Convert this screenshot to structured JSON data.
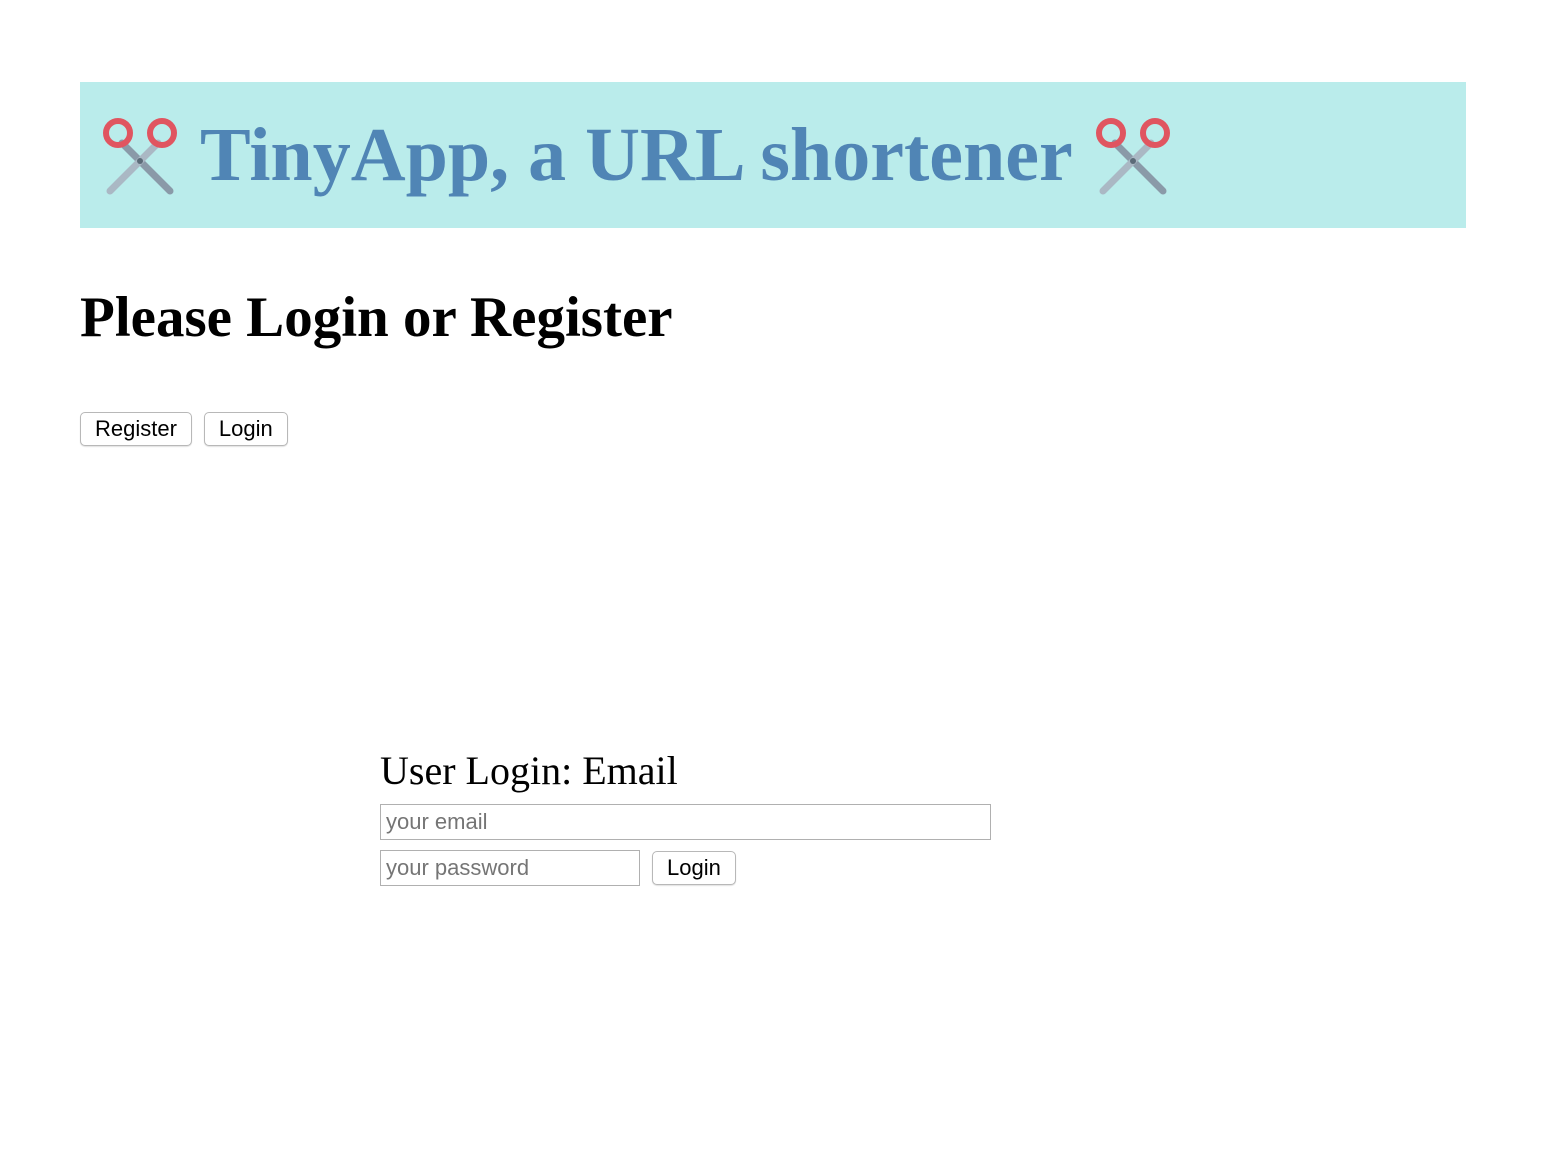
{
  "header": {
    "title": "TinyApp, a URL shortener",
    "background_color": "#baeceb",
    "title_color": "#5085b5",
    "left_icon": "scissors-icon",
    "right_icon": "scissors-icon"
  },
  "page": {
    "title": "Please Login or Register"
  },
  "nav": {
    "register_label": "Register",
    "login_label": "Login"
  },
  "login_form": {
    "heading": "User Login: Email",
    "email_placeholder": "your email",
    "email_value": "",
    "password_placeholder": "your password",
    "password_value": "",
    "submit_label": "Login"
  }
}
